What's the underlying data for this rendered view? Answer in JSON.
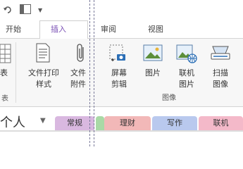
{
  "tabs": {
    "start": "开始",
    "insert": "插入",
    "review": "审阅",
    "view": "视图"
  },
  "ribbon": {
    "table_label": "表",
    "table_group": "表",
    "file_printout": [
      "文件打印",
      "样式"
    ],
    "file_attach": [
      "文件",
      "附件"
    ],
    "screenshot": [
      "屏幕",
      "剪辑"
    ],
    "picture": "图片",
    "online_picture": [
      "联机",
      "图片"
    ],
    "scan": [
      "扫描",
      "图像"
    ],
    "images_group": "图像"
  },
  "notebook": {
    "name": "个人"
  },
  "sections": [
    {
      "label": "常规",
      "color": "#d9b8e0"
    },
    {
      "label": "理财",
      "color": "#f2b8b8"
    },
    {
      "label": "写作",
      "color": "#b9c9ee"
    },
    {
      "label": "联机",
      "color": "#f4b9c9"
    }
  ],
  "colors": {
    "accent": "#7a4fb4",
    "screenshot_icon": "#2c6fb6"
  }
}
